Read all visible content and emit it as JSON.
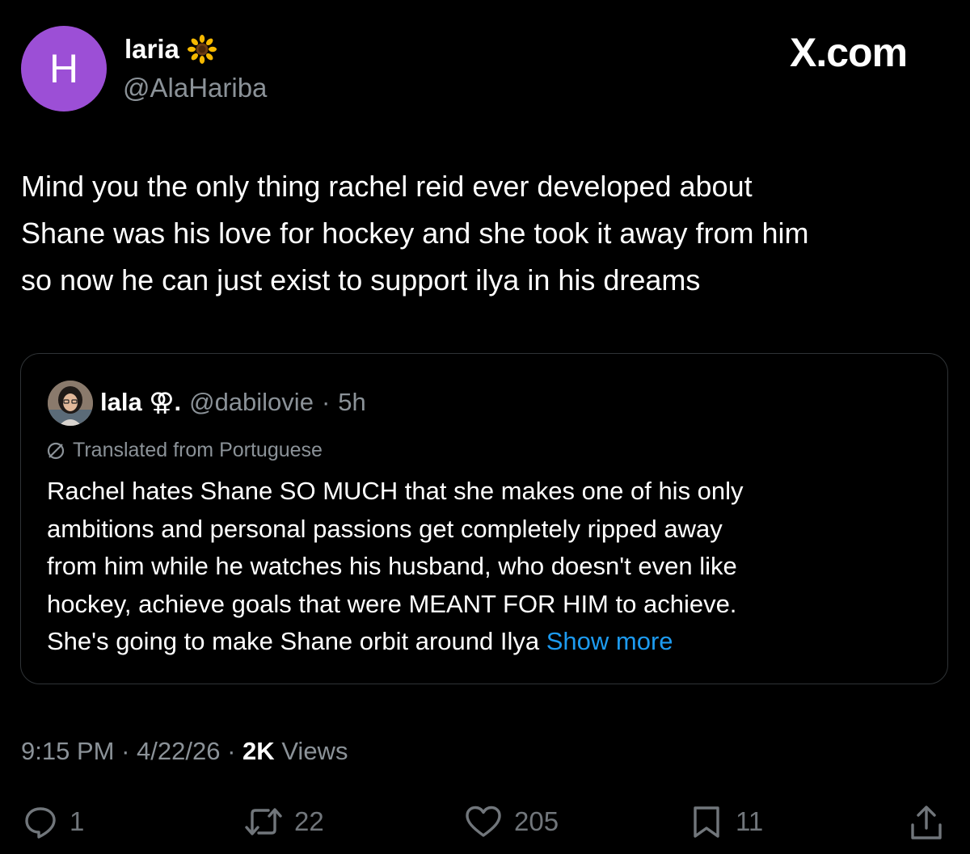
{
  "author": {
    "avatar_letter": "H",
    "avatar_color": "#9c4fd6",
    "display_name": "laria",
    "name_emoji": "sunflower-icon",
    "handle": "@AlaHariba"
  },
  "brand": "X.com",
  "tweet": {
    "lines": [
      "Mind you the only thing rachel reid ever developed about",
      "Shane was his love for hockey and she took it away from him",
      "so now he can just exist to support ilya in his dreams"
    ]
  },
  "quote": {
    "display_name": "lala",
    "name_symbol": "⚢.",
    "handle": "@dabilovie",
    "separator": "·",
    "time": "5h",
    "translated_label": "Translated from Portuguese",
    "lines": [
      "Rachel hates Shane SO MUCH that she makes one of his only",
      "ambitions and personal passions get completely ripped away",
      "from him while he watches his husband, who doesn't even like",
      "hockey, achieve goals that were MEANT FOR HIM to achieve."
    ],
    "last_line": "She's going to make Shane orbit around Ilya",
    "show_more": "Show more"
  },
  "meta": {
    "time": "9:15 PM",
    "date": "4/22/26",
    "separator": "·",
    "views_count": "2K",
    "views_label": "Views"
  },
  "actions": {
    "replies": "1",
    "reposts": "22",
    "likes": "205",
    "bookmarks": "11"
  },
  "colors": {
    "background": "#000000",
    "accent": "#1d9bf0",
    "muted": "#8b9298"
  }
}
